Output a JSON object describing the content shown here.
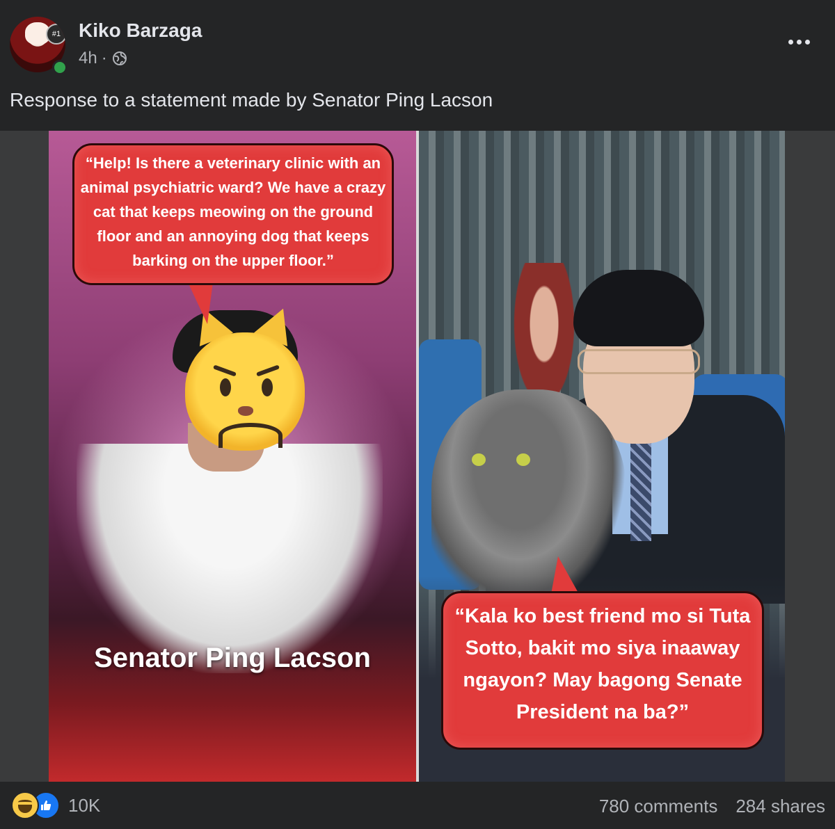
{
  "post": {
    "author": "Kiko Barzaga",
    "timestamp": "4h",
    "separator": "·",
    "privacy_icon": "globe-icon",
    "more_icon": "more-options-icon",
    "caption": "Response to a statement made by Senator Ping Lacson",
    "online": true
  },
  "image": {
    "left_panel": {
      "quote": "“Help! Is there a veterinary clinic with an animal psychiatric ward? We have a crazy cat that keeps meowing on the ground floor and an annoying dog that keeps barking on the upper floor.”",
      "name_label": "Senator Ping Lacson"
    },
    "right_panel": {
      "quote": "“Kala ko best friend mo si Tuta Sotto, bakit mo siya inaaway ngayon? May bagong Senate President na ba?”"
    }
  },
  "footer": {
    "reactions": [
      "haha-reaction-icon",
      "like-reaction-icon"
    ],
    "reaction_count": "10K",
    "comments": "780 comments",
    "shares": "284 shares"
  },
  "colors": {
    "background": "#242526",
    "text_primary": "#e4e6eb",
    "text_secondary": "#b0b3b8",
    "bubble_red": "#e13b3b",
    "like_blue": "#1877f2",
    "online_green": "#31a24c"
  }
}
